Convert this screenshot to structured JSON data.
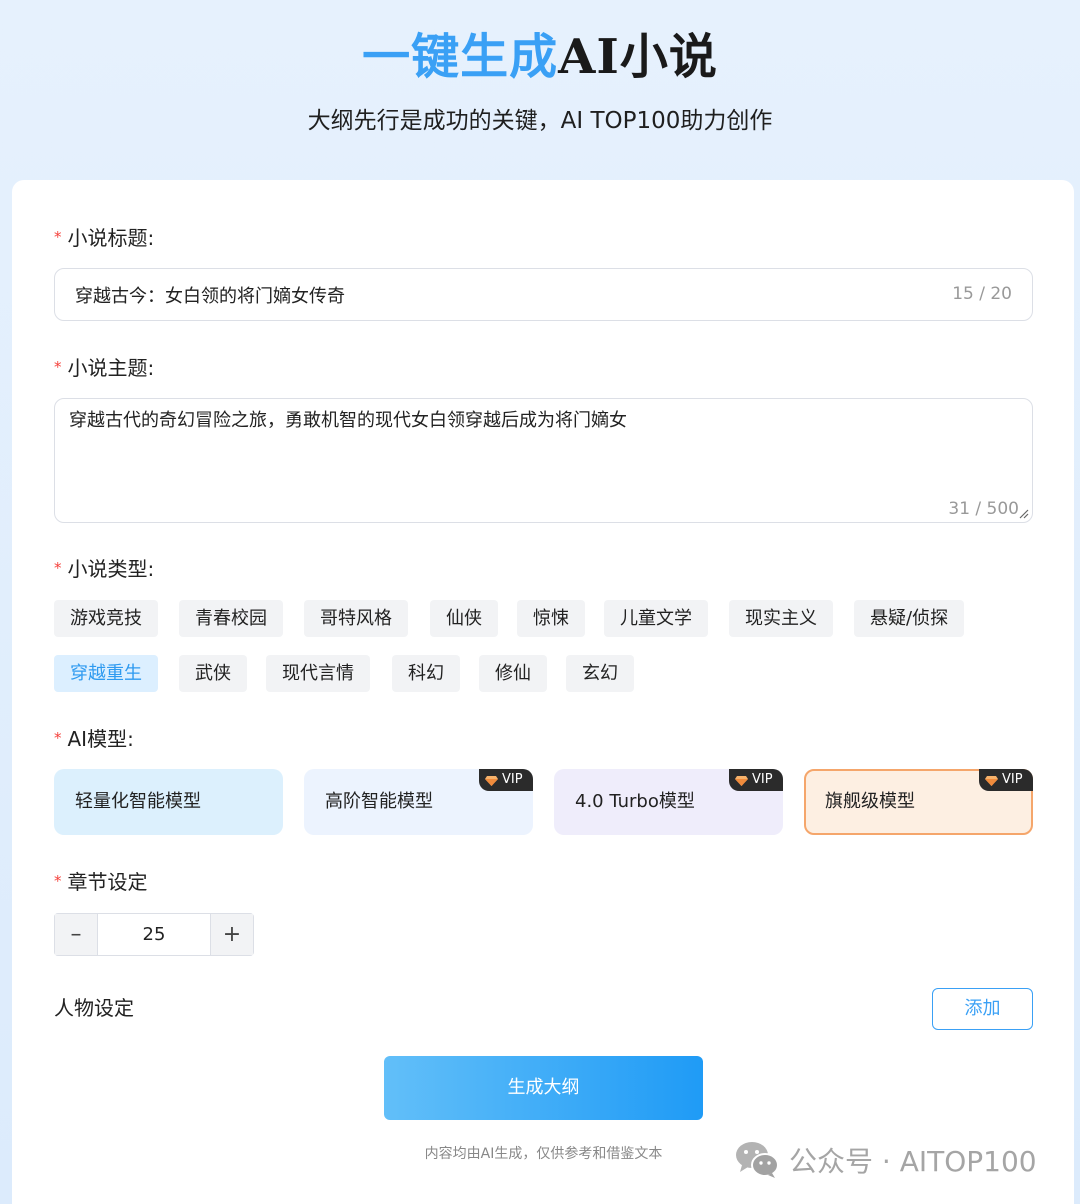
{
  "header": {
    "title_blue": "一键生成",
    "title_dark": "AI小说",
    "subtitle": "大纲先行是成功的关键，AI TOP100助力创作"
  },
  "form": {
    "required_mark": "*",
    "title_field": {
      "label": "小说标题:",
      "value": "穿越古今：女白领的将门嫡女传奇",
      "counter": "15 / 20"
    },
    "theme_field": {
      "label": "小说主题:",
      "value": "穿越古代的奇幻冒险之旅，勇敢机智的现代女白领穿越后成为将门嫡女",
      "counter": "31 / 500"
    },
    "genre": {
      "label": "小说类型:",
      "tags": [
        "游戏竞技",
        "青春校园",
        "哥特风格",
        "仙侠",
        "惊悚",
        "儿童文学",
        "现实主义",
        "悬疑/侦探",
        "穿越重生",
        "武侠",
        "现代言情",
        "科幻",
        "修仙",
        "玄幻"
      ],
      "selected": "穿越重生"
    },
    "model": {
      "label": "AI模型:",
      "vip_label": "VIP",
      "options": [
        {
          "label": "轻量化智能模型",
          "vip": false,
          "bg": "#dcf0fd"
        },
        {
          "label": "高阶智能模型",
          "vip": true,
          "bg": "#ecf3fe"
        },
        {
          "label": "4.0 Turbo模型",
          "vip": true,
          "bg": "#efedfb"
        },
        {
          "label": "旗舰级模型",
          "vip": true,
          "bg": "#fdefe2"
        }
      ],
      "selected": "旗舰级模型"
    },
    "chapters": {
      "label": "章节设定",
      "value": "25",
      "minus": "–",
      "plus": "+"
    },
    "characters": {
      "label": "人物设定",
      "add_label": "添加"
    },
    "generate_label": "生成大纲",
    "disclaimer": "内容均由AI生成，仅供参考和借鉴文本"
  },
  "watermark": {
    "text": "公众号 · AITOP100",
    "icon": "wechat-icon"
  },
  "colors": {
    "accent": "#3aa0f5",
    "required": "#f5413c",
    "selected_border": "#f5a66b"
  }
}
